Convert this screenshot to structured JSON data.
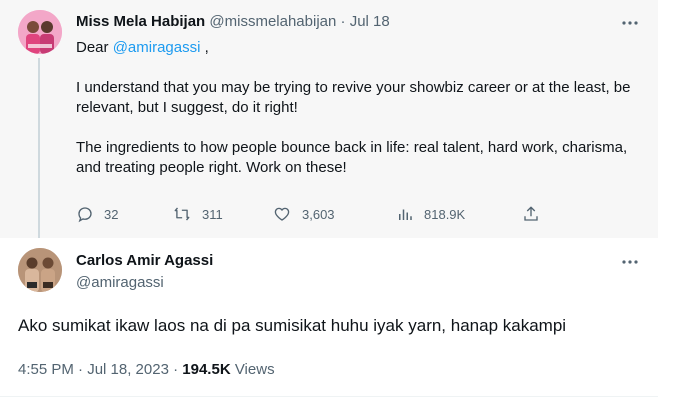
{
  "tweet": {
    "author_name": "Miss Mela Habijan",
    "author_handle": "@missmelahabijan",
    "separator": "·",
    "date": "Jul 18",
    "greeting_prefix": "Dear ",
    "greeting_mention": "@amiragassi",
    "greeting_suffix": " ,",
    "paragraph_1": "I understand that you may be trying to revive your showbiz career or at the least, be relevant, but I suggest, do it right!",
    "paragraph_2": "The ingredients to how people bounce back in life: real talent, hard work, charisma, and treating people right. Work on these!",
    "stats": {
      "replies": "32",
      "retweets": "311",
      "likes": "3,603",
      "views": "818.9K"
    }
  },
  "reply": {
    "author_name": "Carlos Amir Agassi",
    "author_handle": "@amiragassi",
    "text": "Ako sumikat ikaw laos na di pa sumisikat huhu iyak yarn, hanap kakampi",
    "timestamp": "4:55 PM · Jul 18, 2023",
    "separator": "·",
    "views_count": "194.5K",
    "views_label": "Views"
  },
  "icons": {
    "more": "more-icon",
    "reply": "reply-icon",
    "retweet": "retweet-icon",
    "like": "heart-icon",
    "views": "views-icon",
    "share": "share-icon"
  },
  "colors": {
    "link": "#1d9bf0",
    "muted_text": "#536471",
    "primary_text": "#0f1419",
    "parent_background": "#f7f7f7"
  }
}
